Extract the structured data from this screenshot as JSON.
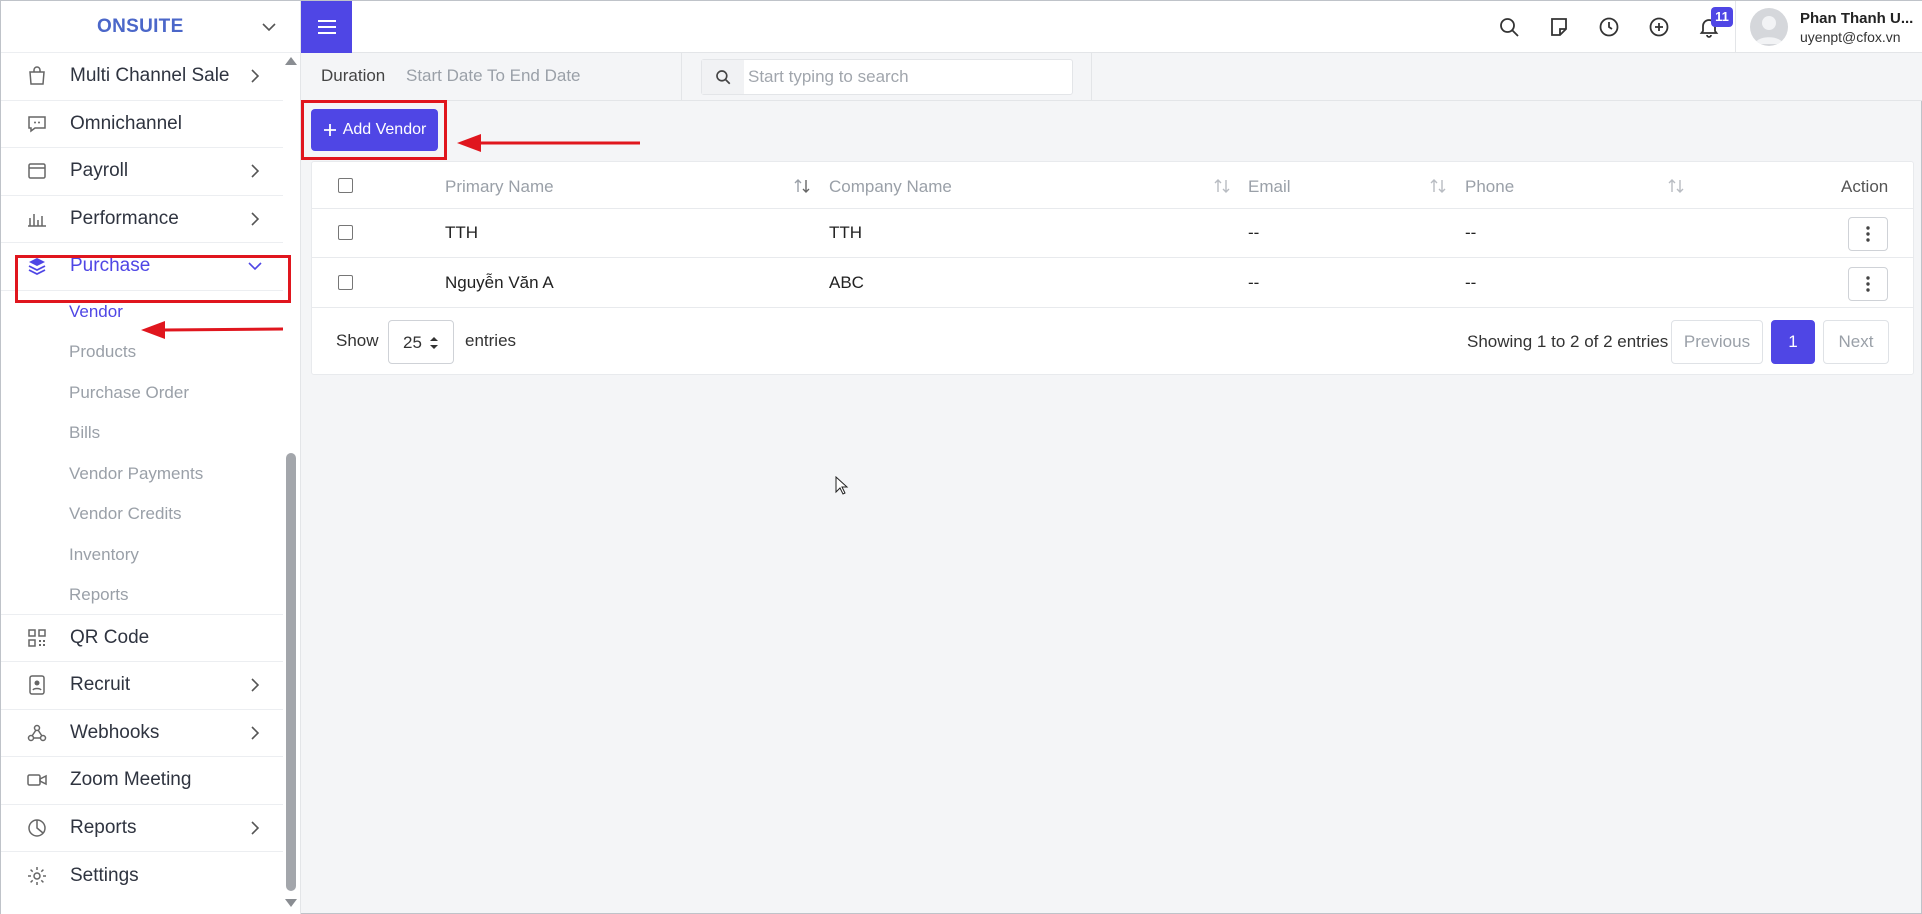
{
  "sidebar": {
    "brand": "ONSUITE",
    "items": [
      {
        "label": "Multi Channel Sale",
        "icon": "bag-icon",
        "has_children": true
      },
      {
        "label": "Omnichannel",
        "icon": "chat-icon",
        "has_children": false
      },
      {
        "label": "Payroll",
        "icon": "wallet-icon",
        "has_children": true
      },
      {
        "label": "Performance",
        "icon": "bar-chart-icon",
        "has_children": true
      },
      {
        "label": "Purchase",
        "icon": "layers-icon",
        "has_children": true,
        "expanded": true
      }
    ],
    "purchase_sub": [
      "Vendor",
      "Products",
      "Purchase Order",
      "Bills",
      "Vendor Payments",
      "Vendor Credits",
      "Inventory",
      "Reports"
    ],
    "items_after": [
      {
        "label": "QR Code",
        "icon": "qr-code-icon",
        "has_children": false
      },
      {
        "label": "Recruit",
        "icon": "badge-icon",
        "has_children": true
      },
      {
        "label": "Webhooks",
        "icon": "webhook-icon",
        "has_children": true
      },
      {
        "label": "Zoom Meeting",
        "icon": "video-icon",
        "has_children": false
      },
      {
        "label": "Reports",
        "icon": "pie-chart-icon",
        "has_children": true
      },
      {
        "label": "Settings",
        "icon": "gear-icon",
        "has_children": false
      }
    ]
  },
  "header": {
    "notifications_count": "11",
    "user_name": "Phan Thanh U...",
    "user_email": "uyenpt@cfox.vn"
  },
  "filters": {
    "duration_label": "Duration",
    "date_range_placeholder": "Start Date To End Date",
    "search_placeholder": "Start typing to search"
  },
  "toolbar": {
    "add_vendor_label": "Add Vendor"
  },
  "table": {
    "columns": [
      "Primary Name",
      "Company Name",
      "Email",
      "Phone",
      "Action"
    ],
    "rows": [
      {
        "primary_name": "TTH",
        "company_name": "TTH",
        "email": "--",
        "phone": "--"
      },
      {
        "primary_name": "Nguyễn Văn A",
        "company_name": "ABC",
        "email": "--",
        "phone": "--"
      }
    ]
  },
  "footer": {
    "show_label": "Show",
    "page_size": "25",
    "entries_label": "entries",
    "info": "Showing 1 to 2 of 2 entries",
    "previous_label": "Previous",
    "current_page": "1",
    "next_label": "Next"
  },
  "colors": {
    "accent": "#4f46e5",
    "brand": "#4b67c9",
    "annotation_red": "#e0161e"
  }
}
